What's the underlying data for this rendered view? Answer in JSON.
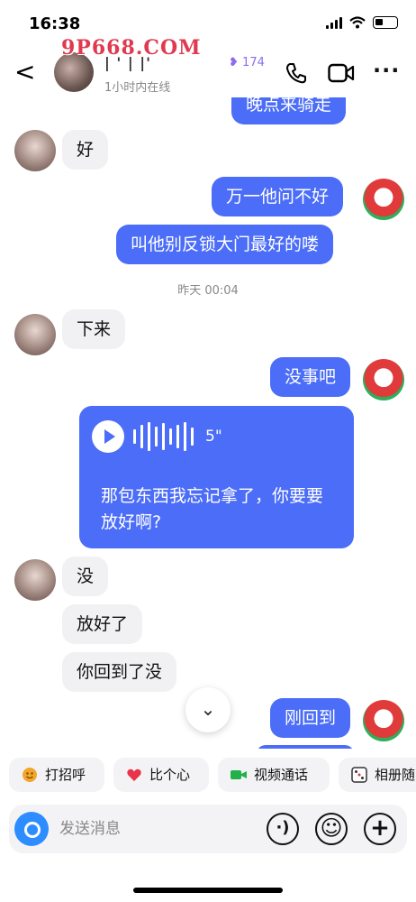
{
  "status_bar": {
    "time": "16:38"
  },
  "header": {
    "back_glyph": "<",
    "name": "| ' | |'",
    "status": "1小时内在线",
    "badge": "174",
    "more_glyph": "···"
  },
  "watermark": "9P668.COM",
  "messages": {
    "partial_top": "晚点来骑走",
    "m1": "好",
    "m2": "万一他问不好",
    "m3": "叫他别反锁大门最好的喽",
    "timestamp": "昨天 00:04",
    "m4": "下来",
    "m5": "没事吧",
    "voice": {
      "duration": "5\"",
      "text": "那包东西我忘记拿了，你要要放好啊?"
    },
    "m6": "没",
    "m7": "放好了",
    "m8": "你回到了没",
    "m9": "刚回到"
  },
  "scroll_down_glyph": "⌄",
  "quick_actions": [
    {
      "label": "打招呼",
      "icon": "wave-emoji-icon",
      "color": "#f4a52b"
    },
    {
      "label": "比个心",
      "icon": "heart-icon",
      "color": "#e8344a"
    },
    {
      "label": "视频通话",
      "icon": "video-camera-icon",
      "color": "#22b04b"
    },
    {
      "label": "相册随",
      "icon": "dice-icon",
      "color": "#333333"
    }
  ],
  "input": {
    "placeholder": "发送消息",
    "voice_glyph": "·)",
    "emoji_glyph": "☺",
    "plus_glyph": "+"
  },
  "colors": {
    "outgoing_bubble": "#4b6df7",
    "incoming_bubble": "#f1f1f3",
    "accent": "#2d8cff",
    "badge": "#8b6cf0"
  }
}
